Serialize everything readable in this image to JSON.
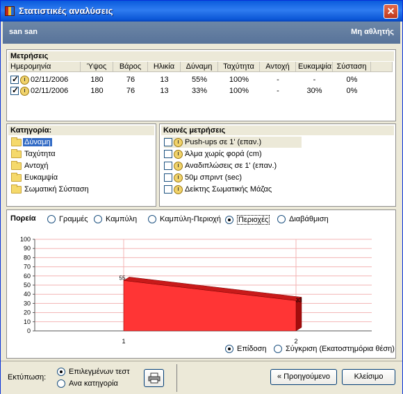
{
  "window": {
    "title": "Στατιστικές αναλύσεις",
    "close_glyph": "✕"
  },
  "header": {
    "user_name": "san san",
    "status": "Μη αθλητής"
  },
  "measurements": {
    "title": "Μετρήσεις",
    "columns": [
      "Ημερομηνία",
      "Ύψος",
      "Βάρος",
      "Ηλικία",
      "Δύναμη",
      "Ταχύτητα",
      "Αντοχή",
      "Ευκαμψία",
      "Σύσταση",
      ""
    ],
    "rows": [
      {
        "checked": true,
        "date": "02/11/2006",
        "height": "180",
        "weight": "76",
        "age": "13",
        "strength": "55%",
        "speed": "100%",
        "endurance": "-",
        "flexibility": "-",
        "composition": "0%"
      },
      {
        "checked": true,
        "date": "02/11/2006",
        "height": "180",
        "weight": "76",
        "age": "13",
        "strength": "33%",
        "speed": "100%",
        "endurance": "-",
        "flexibility": "30%",
        "composition": "0%"
      }
    ]
  },
  "categories": {
    "title": "Κατηγορία:",
    "items": [
      "Δύναμη",
      "Ταχύτητα",
      "Αντοχή",
      "Ευκαμψία",
      "Σωματική Σύσταση"
    ],
    "selected": 0
  },
  "common": {
    "title": "Κοινές μετρήσεις",
    "items": [
      "Push-ups σε 1' (επαν.)",
      "Άλμα χωρίς φορά (cm)",
      "Αναδιπλώσεις σε 1' (επαν.)",
      "50μ σπριντ (sec)",
      "Δείκτης Σωματικής Μάζας"
    ],
    "selected": 0
  },
  "course": {
    "title": "Πορεία",
    "options": [
      "Γραμμές",
      "Καμπύλη",
      "Καμπύλη-Περιοχή",
      "Περιοχές",
      "Διαβάθμιση"
    ],
    "selected": 3,
    "bottom_options": [
      "Επίδοση",
      "Σύγκριση (Εκατοστημόρια θέση)"
    ],
    "bottom_selected": 0
  },
  "chart_data": {
    "type": "area",
    "x": [
      "1",
      "2"
    ],
    "values": [
      55,
      33
    ],
    "data_labels": [
      "55",
      "33"
    ],
    "ylim": [
      0,
      100
    ],
    "yticks": [
      0,
      10,
      20,
      30,
      40,
      50,
      60,
      70,
      80,
      90,
      100
    ],
    "grid": true,
    "color": "#ff3535"
  },
  "footer": {
    "print_label": "Εκτύπωση:",
    "print_options": [
      "Επιλεγμένων τεστ",
      "Ανα κατηγορία"
    ],
    "print_selected": 0,
    "printer_icon": "printer-icon",
    "prev_button": "« Προηγούμενο",
    "close_button": "Κλείσιμο"
  },
  "colors": {
    "title_bar": "#0a5bdc",
    "header": "#6d87a6",
    "selection": "#316ac5"
  }
}
